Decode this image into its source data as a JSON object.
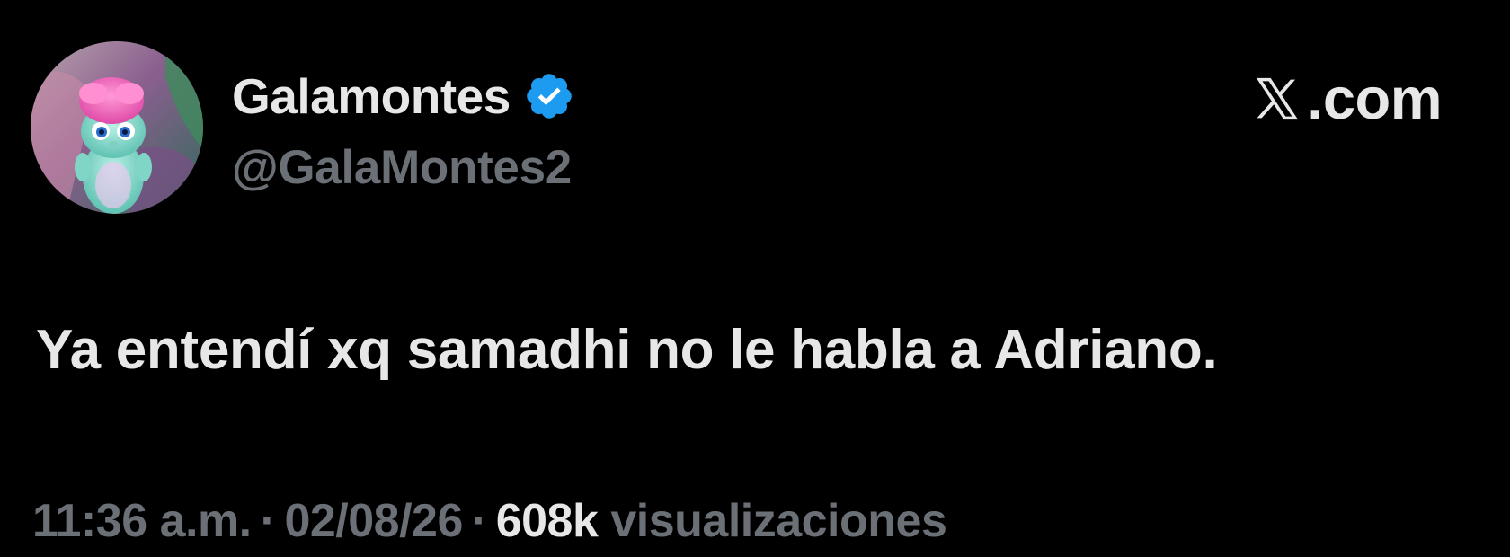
{
  "author": {
    "display_name": "Galamontes",
    "handle": "@GalaMontes2",
    "verified": true,
    "verified_color": "#1d9bf0",
    "avatar_icon": "pink-fluffy-creature-avatar"
  },
  "site": {
    "logo_icon": "x-logo-icon",
    "label": ".com"
  },
  "tweet": {
    "text": "Ya entendí xq samadhi no le habla a Adriano."
  },
  "meta": {
    "time": "11:36 a.m.",
    "separator": "·",
    "date": "02/08/26",
    "views_count": "608k",
    "views_label": "visualizaciones"
  },
  "colors": {
    "background": "#000000",
    "primary_text": "#e7e7e7",
    "secondary_text": "#6b7077"
  }
}
